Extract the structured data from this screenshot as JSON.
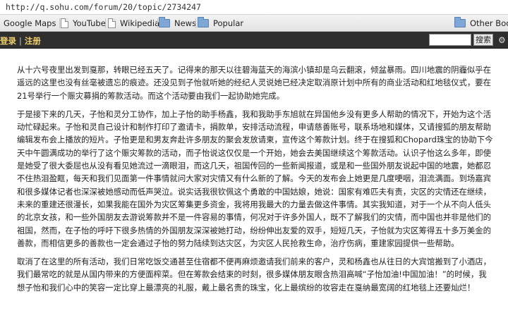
{
  "browser": {
    "url": "http://q.sohu.com/forum/20/topic/2734247",
    "bookmarks": [
      {
        "label": "Google Maps"
      },
      {
        "label": "YouTube"
      },
      {
        "label": "Wikipedia"
      },
      {
        "label": "News"
      },
      {
        "label": "Popular"
      },
      {
        "label": "Other Bookmarks"
      }
    ]
  },
  "site_header": {
    "login_label": "登录",
    "register_label": "注册",
    "separator": "|",
    "search_placeholder": "",
    "search_button_label": "搜索"
  },
  "article": {
    "paragraphs": [
      "从十六号夜里出发到戛那，转眼已经五天了。记得来的那天以往碧海蓝天的海滨小镇却是乌云翻滚，倾盆暴雨。四川地震的阴霾似乎在遥远的这里也没有丝毫被遗忘的痕迹。还没见到子怡就听她的经纪人灵说她已经决定取消原计划中所有的商业活动和红地毯仪式，要在21号举行一个赈灾募捐的筹款活动。而这个活动要由我们一起协助她完成。",
      "于是接下来的几天，子怡和灵分工协作，加上子怡的助手杨鑫，我和我助手东旭就在异国他乡没有更多人帮助的情况下，开始为这个活动忙碌起来。子怡和灵自己设计和制作打印了邀请卡，捐款单，安排活动流程，申请慈善账号，联系场地和媒体，又请搜狐的朋友帮助编辑发布会上播放的短片。子怡更是和男友奔赴许多朋友的聚会发放请柬，宣传这个筹款计划。终于在搜狐和Chopard珠宝的协助下今天中午圆满成功的举行了这个赈灾筹款的活动，而子怡说这仅仅是一个开始，她会去美国继续这个筹款活动。认识子怡这么多年，即使是她受了很大委屈也从没有看见她流过一滴眼泪，而这几天，祖国传回的一些新闻报道，或是和一些国外朋友说起中国的地震，她都忍不住热泪盈眶，每天和我们见面第一件事情就问大家对灾情又有什么新的了解。今天的发布会上她更是几度哽咽，泪流满面。到场嘉宾和很多媒体记者也深深被她感动而低声哭泣。说实话我很钦佩这个勇敢的中国姑娘，她说：国家有难匹夫有责，灾区的灾情还在继续，未来的重建还很漫长，如果我能在国外为灾区筹集更多资金，我将用我最大的力量去做这件事情。其实我知道，对于一个从不向人低头的北京女孩，和一些外国朋友去游说筹款并不是一件容易的事情，何况对于许多外国人，既不了解我们的灾情，而中国也并非是他们的祖国，然而，在子怡的呼吁下很多热情的外国朋友深深被她打动，纷纷伸出友爱的双手，短短几天，子怡就为灾区筹得五十多万美金的善款，而相信更多的善款也一定会通过子怡的努力陆续到达灾区，为灾区人民抢救生命，治疗伤病，重建家园提供一些帮助。",
      "取消了在这里的所有活动，我们日常吃饭交通甚至住宿都不便再麻烦邀请我们前来的客户，灵和杨鑫也从往日的大宾馆搬到了小酒店，我们最常吃的就是从国内带来的方便面榨菜。但在筹款会结束的时刻，很多媒体朋友眼含热泪高喊“子怡加油!中国加油！”的时候，我想子怡和我们心中的笑容一定比穿上最漂亮的礼服，戴上最名贵的珠宝，化上最缤纷的妆容走在戛纳最宽阔的红地毯上还要灿烂！"
    ]
  },
  "colors": {
    "site_header_bg": "#2f2f2f",
    "site_link": "#f2d06b",
    "body_text": "#222222"
  },
  "icons": {
    "bookmark_page": "page-icon",
    "bookmark_folder": "folder-icon",
    "settings": "gear-icon"
  }
}
